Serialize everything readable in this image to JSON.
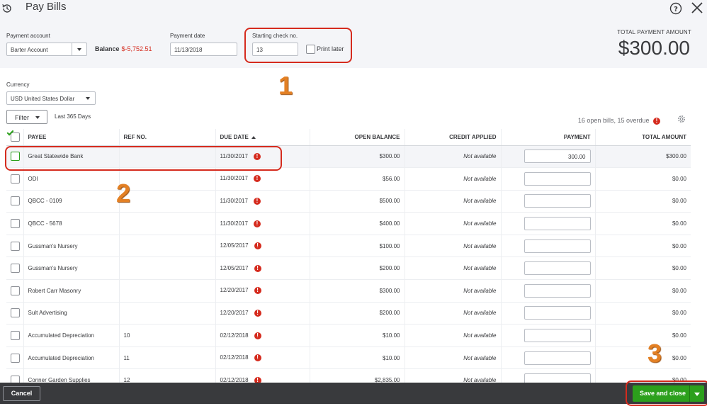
{
  "window": {
    "title": "Pay Bills",
    "help_icon": "help-circle-icon",
    "close_icon": "close-icon",
    "history_icon": "history-clock-icon"
  },
  "header": {
    "payment_account": {
      "label": "Payment account",
      "value": "Barter Account"
    },
    "balance": {
      "label": "Balance",
      "value": "$-5,752.51"
    },
    "payment_date": {
      "label": "Payment date",
      "value": "11/13/2018"
    },
    "starting_check": {
      "label": "Starting check no.",
      "value": "13"
    },
    "print_later": {
      "label": "Print later",
      "checked": false
    },
    "total": {
      "label": "TOTAL PAYMENT AMOUNT",
      "value": "$300.00"
    }
  },
  "currency": {
    "label": "Currency",
    "value": "USD United States Dollar"
  },
  "filter": {
    "button_label": "Filter",
    "range": "Last 365 Days"
  },
  "summary": {
    "text": "16 open bills, 15 overdue"
  },
  "annotations": [
    "1",
    "2",
    "3"
  ],
  "table": {
    "columns": [
      "PAYEE",
      "REF NO.",
      "DUE DATE",
      "OPEN BALANCE",
      "CREDIT APPLIED",
      "PAYMENT",
      "TOTAL AMOUNT"
    ],
    "not_available": "Not available",
    "rows": [
      {
        "payee": "Great Statewide Bank",
        "ref": "",
        "due": "11/30/2017",
        "open": "$300.00",
        "payment": "300.00",
        "total": "$300.00",
        "checked": true
      },
      {
        "payee": "ODI",
        "ref": "",
        "due": "11/30/2017",
        "open": "$56.00",
        "payment": "",
        "total": "$0.00",
        "checked": false
      },
      {
        "payee": "QBCC - 0109",
        "ref": "",
        "due": "11/30/2017",
        "open": "$500.00",
        "payment": "",
        "total": "$0.00",
        "checked": false
      },
      {
        "payee": "QBCC - 5678",
        "ref": "",
        "due": "11/30/2017",
        "open": "$400.00",
        "payment": "",
        "total": "$0.00",
        "checked": false
      },
      {
        "payee": "Gussman's Nursery",
        "ref": "",
        "due": "12/05/2017",
        "open": "$100.00",
        "payment": "",
        "total": "$0.00",
        "checked": false
      },
      {
        "payee": "Gussman's Nursery",
        "ref": "",
        "due": "12/05/2017",
        "open": "$200.00",
        "payment": "",
        "total": "$0.00",
        "checked": false
      },
      {
        "payee": "Robert Carr Masonry",
        "ref": "",
        "due": "12/20/2017",
        "open": "$300.00",
        "payment": "",
        "total": "$0.00",
        "checked": false
      },
      {
        "payee": "Sult Advertising",
        "ref": "",
        "due": "12/20/2017",
        "open": "$200.00",
        "payment": "",
        "total": "$0.00",
        "checked": false
      },
      {
        "payee": "Accumulated Depreciation",
        "ref": "10",
        "due": "02/12/2018",
        "open": "$10.00",
        "payment": "",
        "total": "$0.00",
        "checked": false
      },
      {
        "payee": "Accumulated Depreciation",
        "ref": "11",
        "due": "02/12/2018",
        "open": "$10.00",
        "payment": "",
        "total": "$0.00",
        "checked": false
      },
      {
        "payee": "Conner Garden Supplies",
        "ref": "12",
        "due": "02/12/2018",
        "open": "$2,835.00",
        "payment": "",
        "total": "$0.00",
        "checked": false
      }
    ]
  },
  "footer": {
    "cancel_label": "Cancel",
    "save_label": "Save and close"
  },
  "colors": {
    "accent_green": "#2ca01c",
    "negative_red": "#d52b1e",
    "callout_red": "#d52b1e",
    "annotation_orange": "#e38024",
    "footer_bg": "#393a3d"
  }
}
